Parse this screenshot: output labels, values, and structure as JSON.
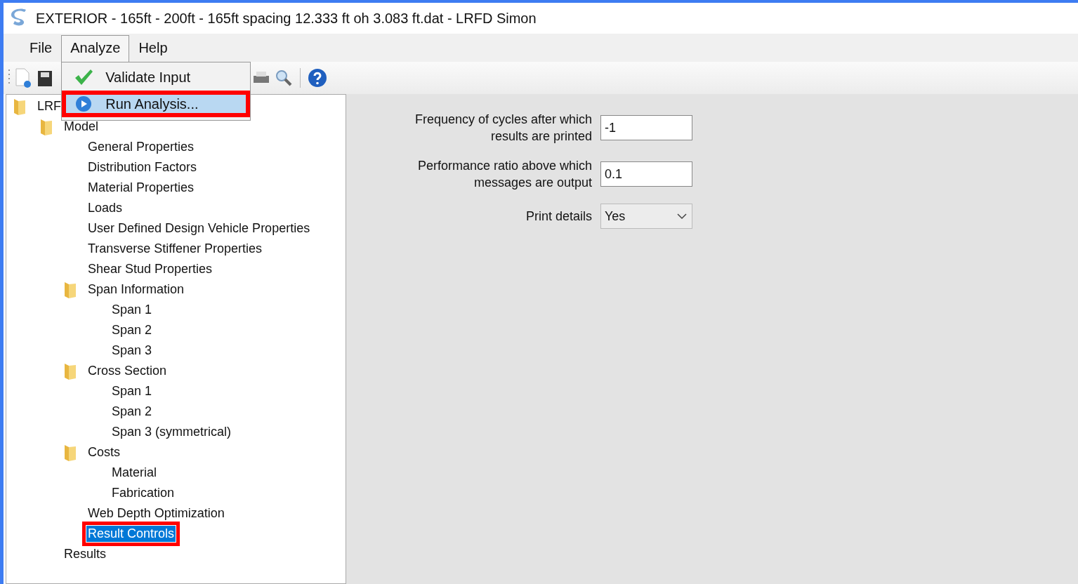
{
  "window": {
    "title": "EXTERIOR - 165ft - 200ft - 165ft spacing 12.333 ft oh 3.083 ft.dat - LRFD Simon"
  },
  "menus": [
    {
      "label": "File",
      "open": false
    },
    {
      "label": "Analyze",
      "open": true,
      "items": [
        {
          "label": "Validate Input",
          "kind": "check",
          "selected": false,
          "highlighted": false
        },
        {
          "label": "Run Analysis...",
          "kind": "play",
          "selected": true,
          "highlighted": true
        }
      ]
    },
    {
      "label": "Help",
      "open": false
    }
  ],
  "tree": {
    "items": [
      {
        "label": "LRF",
        "selected": false,
        "children": [
          {
            "label": "Model",
            "selected": false,
            "highlighted": false,
            "children": [
              {
                "label": "General Properties",
                "selected": false,
                "highlighted": false
              },
              {
                "label": "Distribution Factors",
                "selected": false,
                "highlighted": false
              },
              {
                "label": "Material Properties",
                "selected": false,
                "highlighted": false
              },
              {
                "label": "Loads",
                "selected": false,
                "highlighted": false
              },
              {
                "label": "User Defined Design Vehicle Properties",
                "selected": false,
                "highlighted": false
              },
              {
                "label": "Transverse Stiffener Properties",
                "selected": false,
                "highlighted": false
              },
              {
                "label": "Shear Stud Properties",
                "selected": false,
                "highlighted": false
              },
              {
                "label": "Span Information",
                "selected": false,
                "highlighted": false,
                "children": [
                  {
                    "label": "Span 1",
                    "selected": false,
                    "highlighted": false
                  },
                  {
                    "label": "Span 2",
                    "selected": false,
                    "highlighted": false
                  },
                  {
                    "label": "Span 3",
                    "selected": false,
                    "highlighted": false
                  }
                ]
              },
              {
                "label": "Cross Section",
                "selected": false,
                "highlighted": false,
                "children": [
                  {
                    "label": "Span 1",
                    "selected": false,
                    "highlighted": false
                  },
                  {
                    "label": "Span 2",
                    "selected": false,
                    "highlighted": false
                  },
                  {
                    "label": "Span 3 (symmetrical)",
                    "selected": false,
                    "highlighted": false
                  }
                ]
              },
              {
                "label": "Costs",
                "selected": false,
                "highlighted": false,
                "children": [
                  {
                    "label": "Material",
                    "selected": false,
                    "highlighted": false
                  },
                  {
                    "label": "Fabrication",
                    "selected": false,
                    "highlighted": false
                  }
                ]
              },
              {
                "label": "Web Depth Optimization",
                "selected": false,
                "highlighted": false
              },
              {
                "label": "Result Controls",
                "selected": true,
                "highlighted": true
              }
            ]
          },
          {
            "label": "Results",
            "selected": false,
            "highlighted": false
          }
        ]
      }
    ]
  },
  "form": {
    "fields": [
      {
        "kind": "text",
        "label": "Frequency of cycles after which results are printed",
        "value": "-1"
      },
      {
        "kind": "text",
        "label": "Performance ratio above which messages are output",
        "value": "0.1"
      },
      {
        "kind": "select",
        "label": "Print details",
        "value": "Yes"
      }
    ]
  }
}
